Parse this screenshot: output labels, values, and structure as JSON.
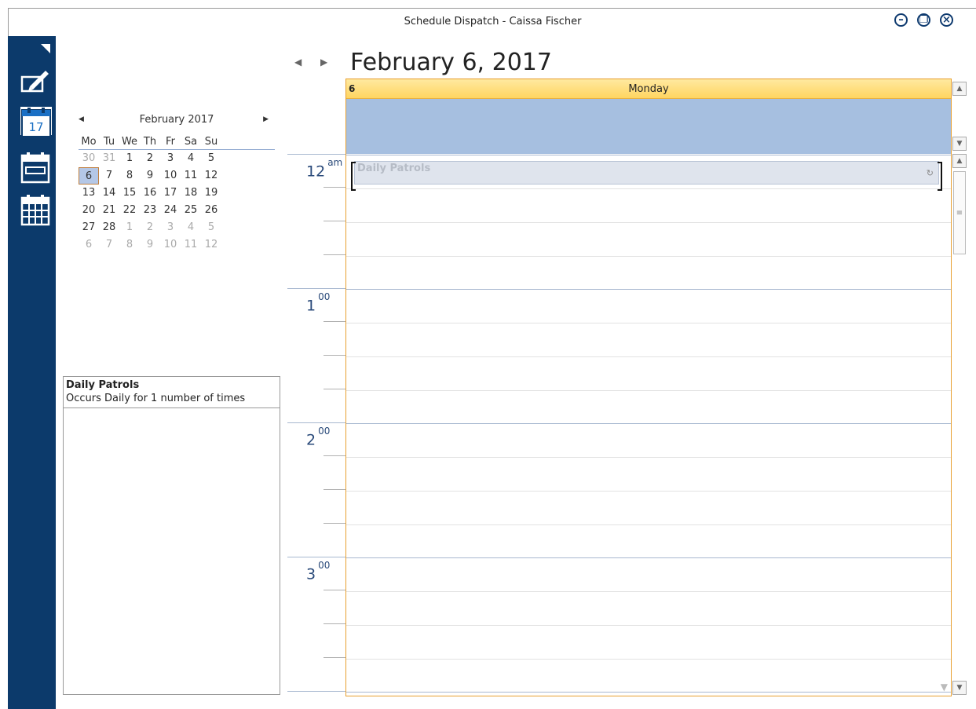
{
  "window": {
    "title": "Schedule Dispatch - Caissa Fischer",
    "minimize_glyph": "–",
    "restore_glyph": "❐",
    "close_glyph": "×"
  },
  "sidebar": {
    "items": [
      {
        "icon": "edit-icon"
      },
      {
        "icon": "calendar-day-icon",
        "label": "17",
        "active": true
      },
      {
        "icon": "calendar-week-icon"
      },
      {
        "icon": "calendar-month-icon"
      }
    ]
  },
  "mini_calendar": {
    "month_label": "February 2017",
    "prev_glyph": "◀",
    "next_glyph": "▶",
    "weekdays": [
      "Mo",
      "Tu",
      "We",
      "Th",
      "Fr",
      "Sa",
      "Su"
    ],
    "days": [
      {
        "d": "30",
        "other": true
      },
      {
        "d": "31",
        "other": true
      },
      {
        "d": "1"
      },
      {
        "d": "2"
      },
      {
        "d": "3"
      },
      {
        "d": "4"
      },
      {
        "d": "5"
      },
      {
        "d": "6",
        "selected": true
      },
      {
        "d": "7"
      },
      {
        "d": "8"
      },
      {
        "d": "9"
      },
      {
        "d": "10"
      },
      {
        "d": "11"
      },
      {
        "d": "12"
      },
      {
        "d": "13"
      },
      {
        "d": "14"
      },
      {
        "d": "15"
      },
      {
        "d": "16"
      },
      {
        "d": "17"
      },
      {
        "d": "18"
      },
      {
        "d": "19"
      },
      {
        "d": "20"
      },
      {
        "d": "21"
      },
      {
        "d": "22"
      },
      {
        "d": "23"
      },
      {
        "d": "24"
      },
      {
        "d": "25"
      },
      {
        "d": "26"
      },
      {
        "d": "27"
      },
      {
        "d": "28"
      },
      {
        "d": "1",
        "other": true
      },
      {
        "d": "2",
        "other": true
      },
      {
        "d": "3",
        "other": true
      },
      {
        "d": "4",
        "other": true
      },
      {
        "d": "5",
        "other": true
      },
      {
        "d": "6",
        "other": true
      },
      {
        "d": "7",
        "other": true
      },
      {
        "d": "8",
        "other": true
      },
      {
        "d": "9",
        "other": true
      },
      {
        "d": "10",
        "other": true
      },
      {
        "d": "11",
        "other": true
      },
      {
        "d": "12",
        "other": true
      }
    ]
  },
  "details": {
    "title": "Daily Patrols",
    "recurrence": "Occurs Daily for 1 number of times"
  },
  "day_view": {
    "heading": "February 6, 2017",
    "prev_glyph": "◀",
    "next_glyph": "▶",
    "day_number": "6",
    "day_name": "Monday",
    "hours": [
      {
        "h": "12",
        "suffix": "am"
      },
      {
        "h": "1",
        "suffix": "00"
      },
      {
        "h": "2",
        "suffix": "00"
      },
      {
        "h": "3",
        "suffix": "00"
      }
    ],
    "appointment": {
      "title": "Daily Patrols",
      "recurrence_glyph": "↻"
    }
  },
  "colors": {
    "sidebar": "#0c3a6b",
    "allday": "#a6bfe0",
    "header": "#ffd560",
    "border_accent": "#e8a030"
  }
}
